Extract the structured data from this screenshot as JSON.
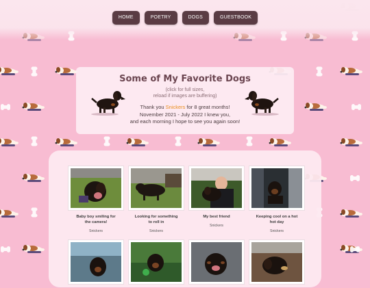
{
  "nav": {
    "items": [
      {
        "label": "HOME"
      },
      {
        "label": "POETRY"
      },
      {
        "label": "DOGS"
      },
      {
        "label": "GUESTBOOK"
      }
    ]
  },
  "header": {
    "title": "Some of My Favorite Dogs",
    "subtitle_line1": "(click for full sizes,",
    "subtitle_line2": "reload if images are buffering)",
    "thanks_prefix": "Thank you ",
    "thanks_link": "Snickers",
    "thanks_suffix": " for 8 great months!",
    "thanks_line2": "November 2021 - July 2022 I knew you,",
    "thanks_line3": "and each morning I hope to see you again soon!"
  },
  "gallery": {
    "photos": [
      {
        "caption_line1": "Baby boy smiling for",
        "caption_line2": "the camera!",
        "credit": "Snickers"
      },
      {
        "caption_line1": "Looking for something",
        "caption_line2": "to roll in",
        "credit": "Snickers"
      },
      {
        "caption_line1": "My best friend",
        "caption_line2": "",
        "credit": "Snickers"
      },
      {
        "caption_line1": "Keeping cool on a hot",
        "caption_line2": "hot day",
        "credit": "Snickers"
      },
      {
        "caption_line1": "",
        "caption_line2": "",
        "credit": ""
      },
      {
        "caption_line1": "",
        "caption_line2": "",
        "credit": ""
      },
      {
        "caption_line1": "",
        "caption_line2": "",
        "credit": ""
      },
      {
        "caption_line1": "",
        "caption_line2": "",
        "credit": ""
      }
    ]
  },
  "colors": {
    "background": "#f8bcd2",
    "nav_button": "#5a3c44",
    "link": "#e98d1b",
    "title": "#6b4550"
  },
  "icons": [
    "beagle-sleeping-icon",
    "bone-icon",
    "dachshund-icon"
  ]
}
